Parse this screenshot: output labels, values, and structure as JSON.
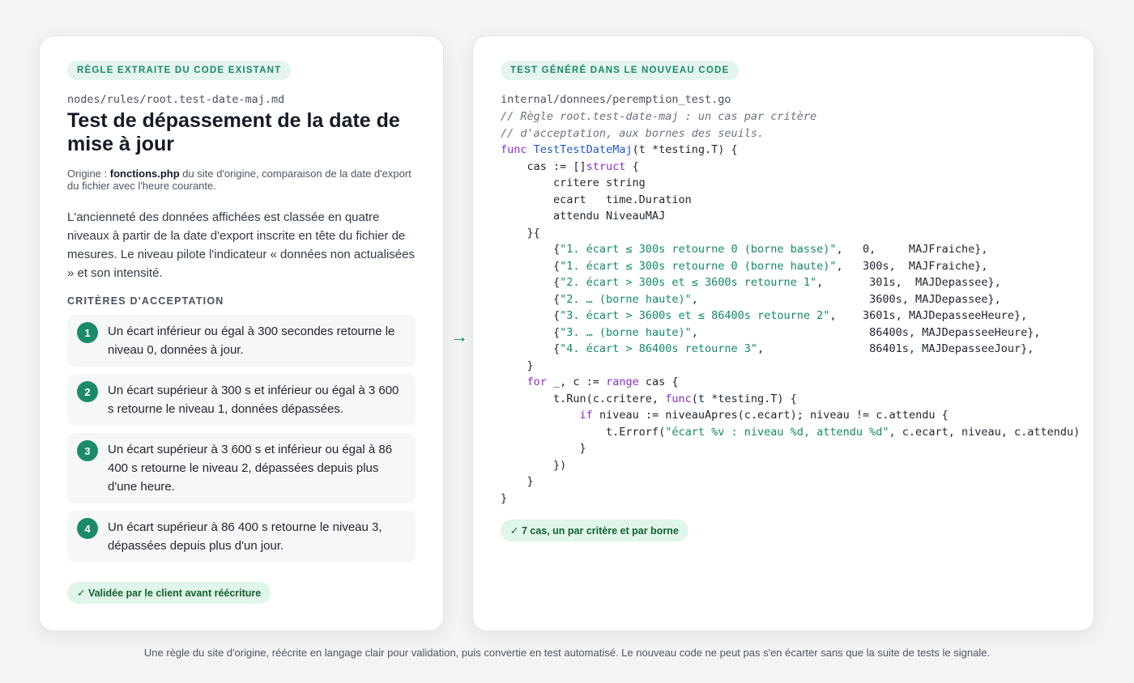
{
  "left": {
    "tag": "Règle extraite du code existant",
    "path": "nodes/rules/root.test-date-maj.md",
    "title": "Test de dépassement de la date de mise à jour",
    "origin_prefix": "Origine : ",
    "origin_file": "fonctions.php",
    "origin_suffix": " du site d'origine, comparaison de la date d'export du fichier avec l'heure courante.",
    "description": "L'ancienneté des données affichées est classée en quatre niveaux à partir de la date d'export inscrite en tête du fichier de mesures. Le niveau pilote l'indicateur « données non actualisées » et son intensité.",
    "criteria_heading": "Critères d'acceptation",
    "criteria": [
      {
        "num": "1",
        "text": "Un écart inférieur ou égal à 300 secondes retourne le niveau 0, données à jour."
      },
      {
        "num": "2",
        "text": "Un écart supérieur à 300 s et inférieur ou égal à 3 600 s retourne le niveau 1, données dépassées."
      },
      {
        "num": "3",
        "text": "Un écart supérieur à 3 600 s et inférieur ou égal à 86 400 s retourne le niveau 2, dépassées depuis plus d'une heure."
      },
      {
        "num": "4",
        "text": "Un écart supérieur à 86 400 s retourne le niveau 3, dépassées depuis plus d'un jour."
      }
    ],
    "badge": "✓ Validée par le client avant réécriture"
  },
  "arrow": "→",
  "right": {
    "tag": "Test généré dans le nouveau code",
    "path": "internal/donnees/peremption_test.go",
    "code": {
      "comment1": "// Règle root.test-date-maj : un cas par critère",
      "comment2": "// d'acceptation, aux bornes des seuils.",
      "kw_func": "func",
      "fn_name": "TestTestDateMaj",
      "sig": "(t *testing.T) {",
      "cas_decl": "    cas := []",
      "kw_struct": "struct",
      "brace_open": " {",
      "field1": "        critere string",
      "field2": "        ecart   time.Duration",
      "field3": "        attendu NiveauMAJ",
      "struct_close": "    }{",
      "rows": [
        {
          "pre": "        {",
          "str": "\"1. écart ≤ 300s retourne 0 (borne basse)\"",
          "rest": ",   0,     MAJFraiche},"
        },
        {
          "pre": "        {",
          "str": "\"1. écart ≤ 300s retourne 0 (borne haute)\"",
          "rest": ",   300s,  MAJFraiche},"
        },
        {
          "pre": "        {",
          "str": "\"2. écart > 300s et ≤ 3600s retourne 1\"",
          "rest": ",       301s,  MAJDepassee},"
        },
        {
          "pre": "        {",
          "str": "\"2. … (borne haute)\"",
          "rest": ",                          3600s, MAJDepassee},"
        },
        {
          "pre": "        {",
          "str": "\"3. écart > 3600s et ≤ 86400s retourne 2\"",
          "rest": ",    3601s, MAJDepasseeHeure},"
        },
        {
          "pre": "        {",
          "str": "\"3. … (borne haute)\"",
          "rest": ",                          86400s, MAJDepasseeHeure},"
        },
        {
          "pre": "        {",
          "str": "\"4. écart > 86400s retourne 3\"",
          "rest": ",                86401s, MAJDepasseeJour},"
        }
      ],
      "rows_close": "    }",
      "for_indent": "    ",
      "kw_for": "for",
      "for_mid": " _, c := ",
      "kw_range": "range",
      "for_end": " cas {",
      "run_pre": "        t.Run(c.critere, ",
      "kw_func2": "func",
      "run_end": "(t *testing.T) {",
      "if_indent": "            ",
      "kw_if": "if",
      "if_rest": " niveau := niveauApres(c.ecart); niveau != c.attendu {",
      "err_pre": "                t.Errorf(",
      "err_str": "\"écart %v : niveau %d, attendu %d\"",
      "err_rest": ", c.ecart, niveau, c.attendu)",
      "close_if": "            }",
      "close_run": "        })",
      "close_for": "    }",
      "close_func": "}"
    },
    "badge": "✓ 7 cas, un par critère et par borne"
  },
  "footer": "Une règle du site d'origine, réécrite en langage clair pour validation, puis convertie en test automatisé. Le nouveau code ne peut pas s'en écarter sans que la suite de tests le signale.",
  "colors": {
    "accent": "#1b8a6b",
    "keyword": "#8b2fc9",
    "function": "#2557c7",
    "string": "#128a68",
    "comment": "#6b7280"
  }
}
